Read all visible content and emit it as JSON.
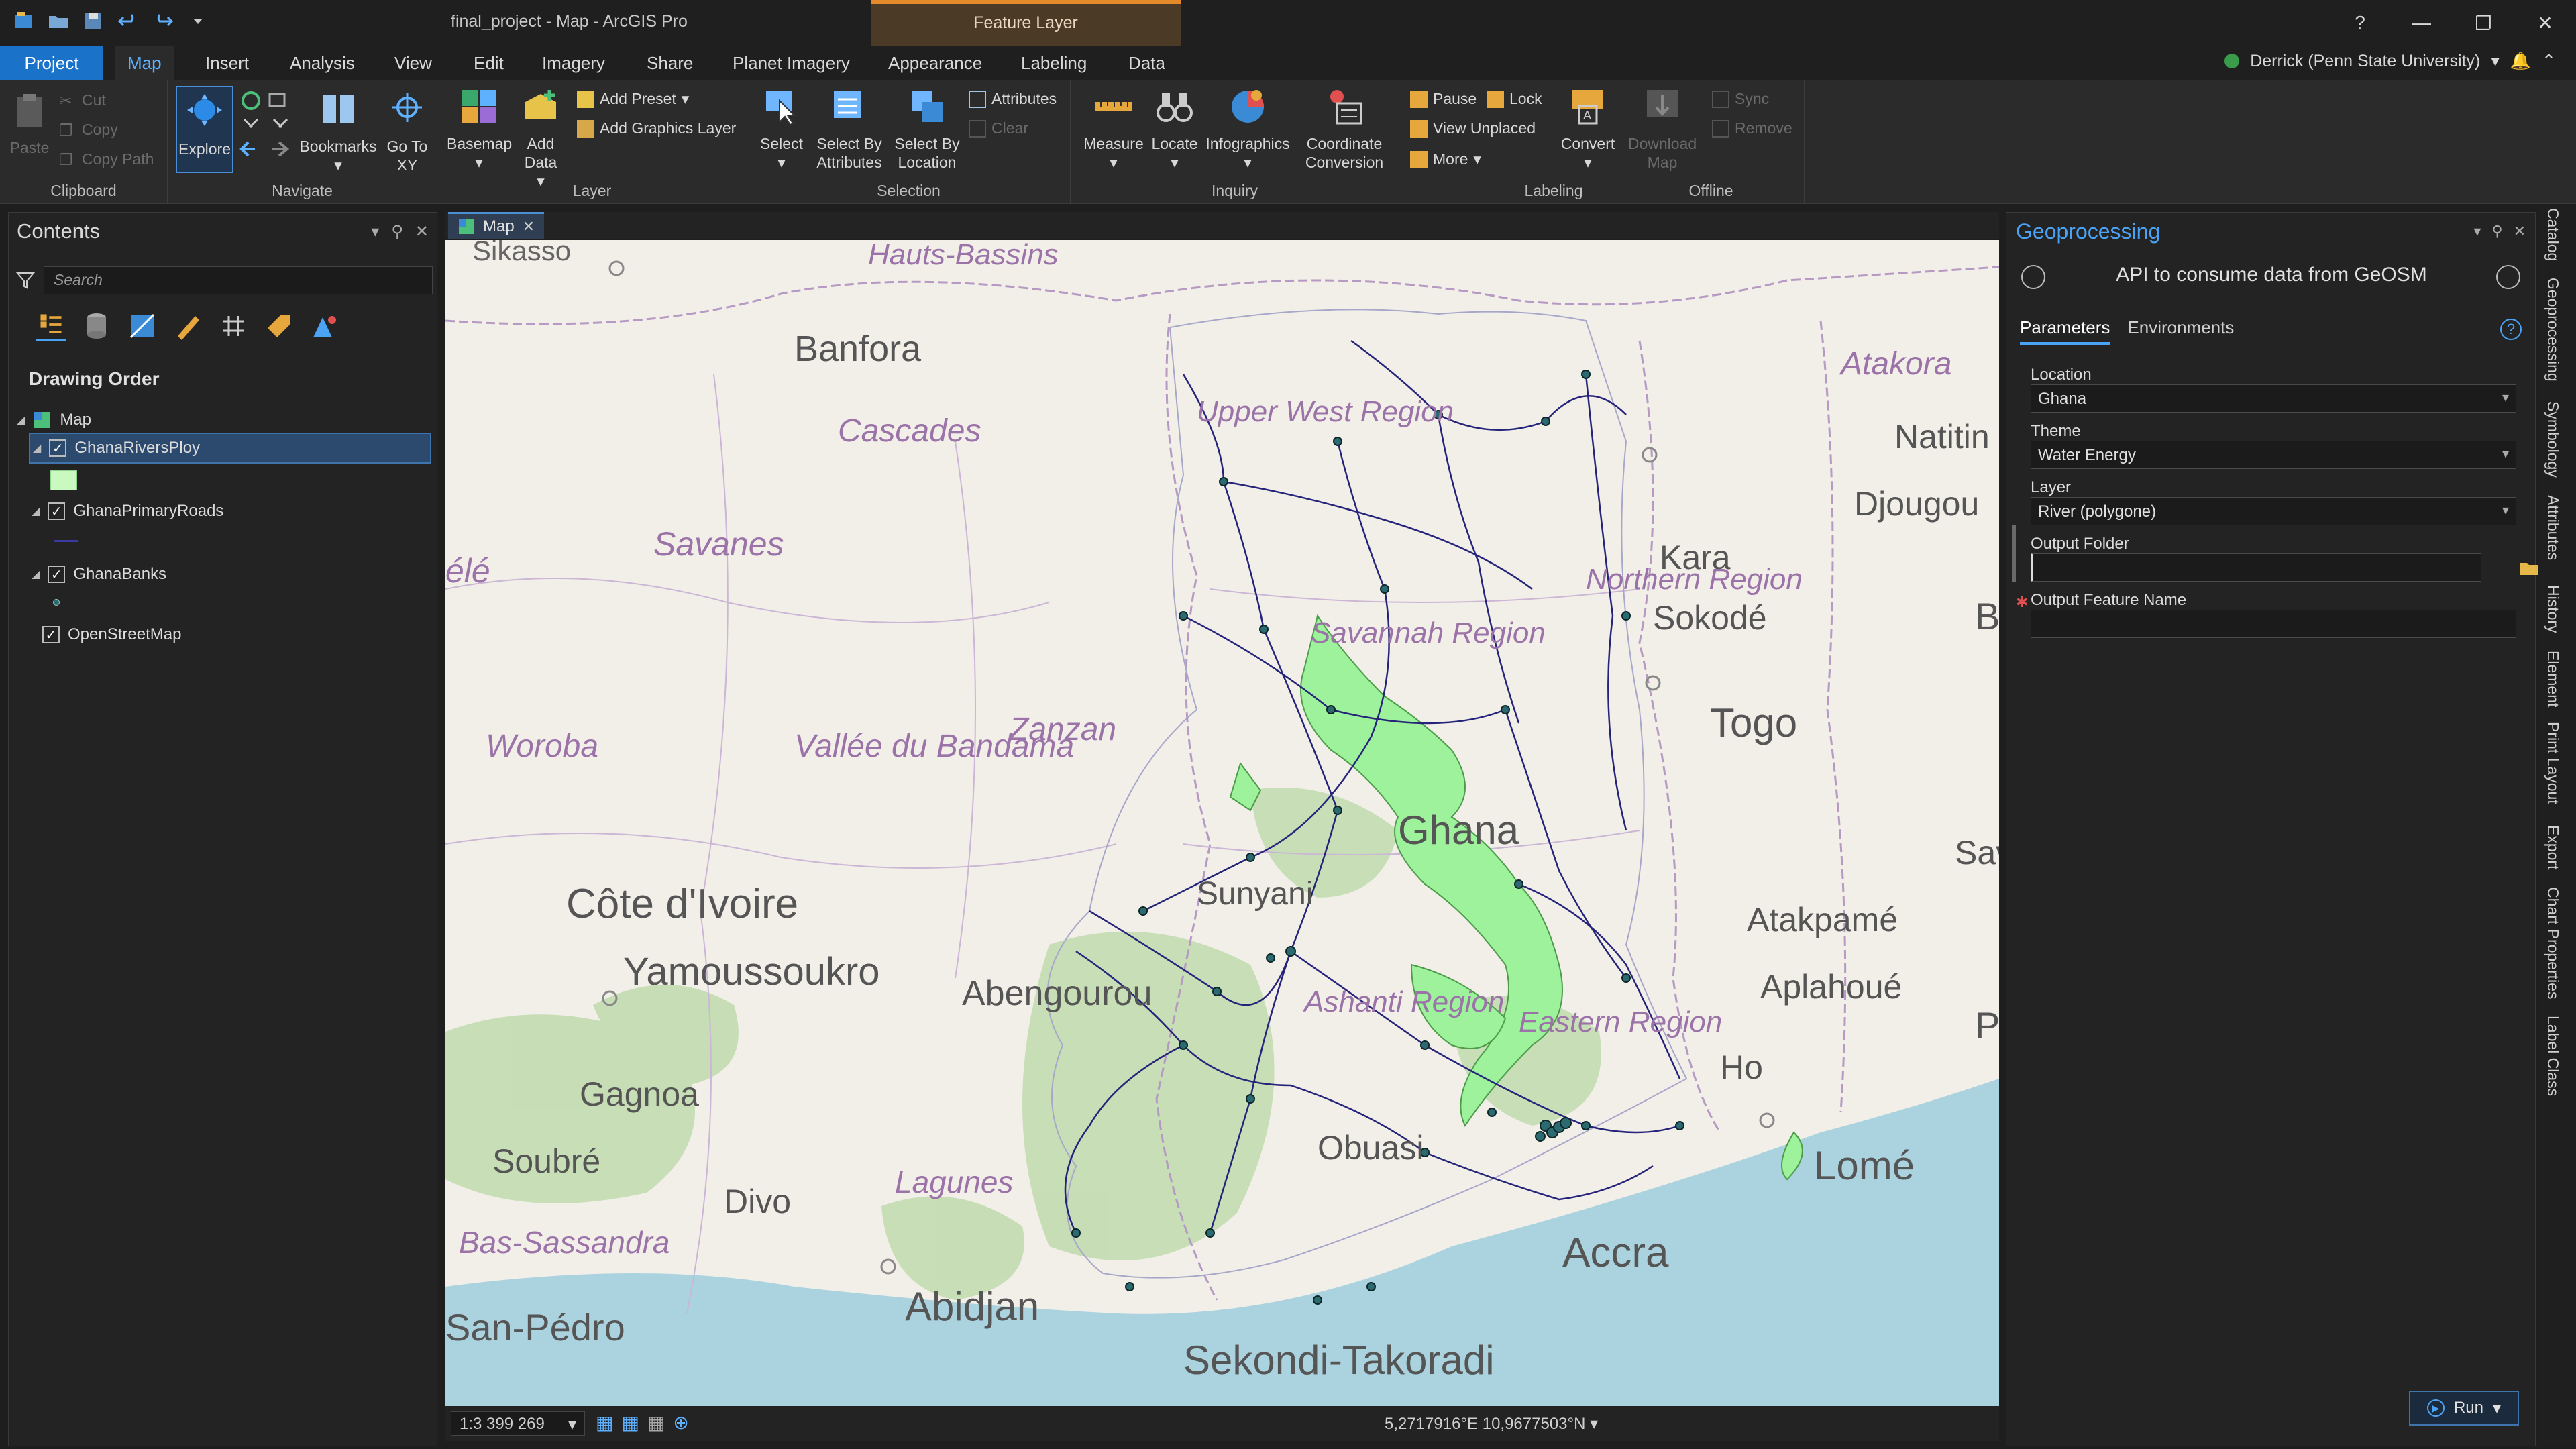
{
  "app": {
    "window_title": "final_project - Map - ArcGIS Pro",
    "contextual_tab": "Feature Layer",
    "help": "?",
    "user": "Derrick (Penn State University)"
  },
  "tabs": [
    "Project",
    "Map",
    "Insert",
    "Analysis",
    "View",
    "Edit",
    "Imagery",
    "Share",
    "Planet Imagery",
    "Appearance",
    "Labeling",
    "Data"
  ],
  "ribbon": {
    "clipboard": {
      "label": "Clipboard",
      "paste": "Paste",
      "cut": "Cut",
      "copy": "Copy",
      "copy_path": "Copy Path"
    },
    "navigate": {
      "label": "Navigate",
      "explore": "Explore",
      "bookmarks": "Bookmarks",
      "go_to_xy": "Go To XY"
    },
    "layer": {
      "label": "Layer",
      "basemap": "Basemap",
      "add_data": "Add Data",
      "add_preset": "Add Preset",
      "add_graphics_layer": "Add Graphics Layer"
    },
    "selection": {
      "label": "Selection",
      "select": "Select",
      "select_by_attributes": "Select By Attributes",
      "select_by_location": "Select By Location",
      "attributes": "Attributes",
      "clear": "Clear"
    },
    "inquiry": {
      "label": "Inquiry",
      "measure": "Measure",
      "locate": "Locate",
      "infographics": "Infographics",
      "coordinate_conversion": "Coordinate Conversion"
    },
    "labeling": {
      "label": "Labeling",
      "pause": "Pause",
      "lock": "Lock",
      "view_unplaced": "View Unplaced",
      "more": "More",
      "convert": "Convert"
    },
    "offline": {
      "label": "Offline",
      "download_map": "Download Map",
      "sync": "Sync",
      "remove": "Remove"
    }
  },
  "contents": {
    "title": "Contents",
    "search_placeholder": "Search",
    "drawing_order": "Drawing Order",
    "map_label": "Map",
    "layers": [
      {
        "name": "GhanaRiversPloy",
        "checked": true,
        "selected": true
      },
      {
        "name": "GhanaPrimaryRoads",
        "checked": true,
        "selected": false
      },
      {
        "name": "GhanaBanks",
        "checked": true,
        "selected": false
      },
      {
        "name": "OpenStreetMap",
        "checked": true,
        "selected": false
      }
    ]
  },
  "map": {
    "tab_label": "Map",
    "scale": "1:3 399 269",
    "coordinates": "5,2717916°E 10,9677503°N",
    "labels": {
      "sikasso": "Sikasso",
      "hauts_bassins": "Hauts-Bassins",
      "banfora": "Banfora",
      "cascades": "Cascades",
      "upper_west": "Upper West Region",
      "atakora": "Atakora",
      "natitingou": "Natitin",
      "djougou": "Djougou",
      "savanes": "Savanes",
      "kara": "Kara",
      "sokode": "Sokodé",
      "northern": "Northern Region",
      "savannah": "Savannah Region",
      "togo": "Togo",
      "woroba": "Woroba",
      "vallee": "Vallée du Bandama",
      "zanzan": "Zanzan",
      "ghana": "Ghana",
      "sava": "Saval",
      "cote": "Côte d'Ivoire",
      "sunyani": "Sunyani",
      "atakpame": "Atakpamé",
      "yamoussoukro": "Yamoussoukro",
      "abengourou": "Abengourou",
      "aplahoue": "Aplahoué",
      "ashanti": "Ashanti Region",
      "eastern": "Eastern Region",
      "ho": "Ho",
      "gagnoa": "Gagnoa",
      "soubre": "Soubré",
      "obuasi": "Obuasi",
      "lagunes": "Lagunes",
      "lome": "Lomé",
      "divo": "Divo",
      "bas_sassandra": "Bas-Sassandra",
      "accra": "Accra",
      "san_pedro": "San-Pédro",
      "abidjan": "Abidjan",
      "sekondi": "Sekondi-Takoradi",
      "ele": "élé",
      "p_edge": "P",
      "b_edge": "B"
    }
  },
  "geoprocessing": {
    "title": "Geoprocessing",
    "tool_name": "API to consume data from GeOSM",
    "tabs": [
      "Parameters",
      "Environments"
    ],
    "params": {
      "location_label": "Location",
      "location_value": "Ghana",
      "theme_label": "Theme",
      "theme_value": "Water Energy",
      "layer_label": "Layer",
      "layer_value": "River (polygone)",
      "output_folder_label": "Output Folder",
      "output_folder_value": "",
      "output_feature_label": "Output Feature Name",
      "output_feature_value": ""
    },
    "run": "Run"
  },
  "dock_tabs": [
    "Catalog",
    "Geoprocessing",
    "Symbology",
    "Attributes",
    "History",
    "Element",
    "Print Layout",
    "Export",
    "Chart Properties",
    "Label Class"
  ],
  "colors": {
    "accent": "#1a73c9",
    "contextual": "#e58a2a",
    "lake": "#9ef29c",
    "roads": "#26247a",
    "ocean": "#aad3df",
    "land": "#f2efe9"
  }
}
